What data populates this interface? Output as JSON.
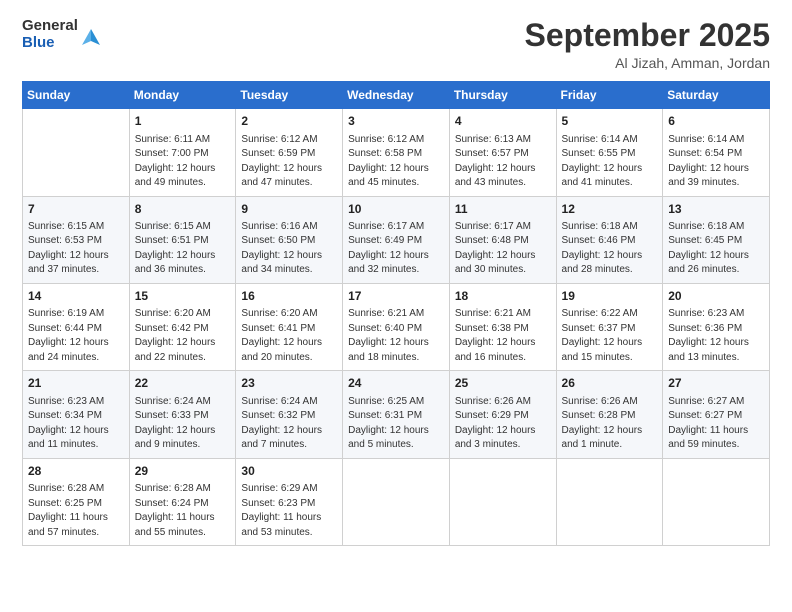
{
  "logo": {
    "line1": "General",
    "line2": "Blue"
  },
  "header": {
    "month": "September 2025",
    "location": "Al Jizah, Amman, Jordan"
  },
  "weekdays": [
    "Sunday",
    "Monday",
    "Tuesday",
    "Wednesday",
    "Thursday",
    "Friday",
    "Saturday"
  ],
  "weeks": [
    [
      {
        "day": "",
        "info": ""
      },
      {
        "day": "1",
        "info": "Sunrise: 6:11 AM\nSunset: 7:00 PM\nDaylight: 12 hours\nand 49 minutes."
      },
      {
        "day": "2",
        "info": "Sunrise: 6:12 AM\nSunset: 6:59 PM\nDaylight: 12 hours\nand 47 minutes."
      },
      {
        "day": "3",
        "info": "Sunrise: 6:12 AM\nSunset: 6:58 PM\nDaylight: 12 hours\nand 45 minutes."
      },
      {
        "day": "4",
        "info": "Sunrise: 6:13 AM\nSunset: 6:57 PM\nDaylight: 12 hours\nand 43 minutes."
      },
      {
        "day": "5",
        "info": "Sunrise: 6:14 AM\nSunset: 6:55 PM\nDaylight: 12 hours\nand 41 minutes."
      },
      {
        "day": "6",
        "info": "Sunrise: 6:14 AM\nSunset: 6:54 PM\nDaylight: 12 hours\nand 39 minutes."
      }
    ],
    [
      {
        "day": "7",
        "info": "Sunrise: 6:15 AM\nSunset: 6:53 PM\nDaylight: 12 hours\nand 37 minutes."
      },
      {
        "day": "8",
        "info": "Sunrise: 6:15 AM\nSunset: 6:51 PM\nDaylight: 12 hours\nand 36 minutes."
      },
      {
        "day": "9",
        "info": "Sunrise: 6:16 AM\nSunset: 6:50 PM\nDaylight: 12 hours\nand 34 minutes."
      },
      {
        "day": "10",
        "info": "Sunrise: 6:17 AM\nSunset: 6:49 PM\nDaylight: 12 hours\nand 32 minutes."
      },
      {
        "day": "11",
        "info": "Sunrise: 6:17 AM\nSunset: 6:48 PM\nDaylight: 12 hours\nand 30 minutes."
      },
      {
        "day": "12",
        "info": "Sunrise: 6:18 AM\nSunset: 6:46 PM\nDaylight: 12 hours\nand 28 minutes."
      },
      {
        "day": "13",
        "info": "Sunrise: 6:18 AM\nSunset: 6:45 PM\nDaylight: 12 hours\nand 26 minutes."
      }
    ],
    [
      {
        "day": "14",
        "info": "Sunrise: 6:19 AM\nSunset: 6:44 PM\nDaylight: 12 hours\nand 24 minutes."
      },
      {
        "day": "15",
        "info": "Sunrise: 6:20 AM\nSunset: 6:42 PM\nDaylight: 12 hours\nand 22 minutes."
      },
      {
        "day": "16",
        "info": "Sunrise: 6:20 AM\nSunset: 6:41 PM\nDaylight: 12 hours\nand 20 minutes."
      },
      {
        "day": "17",
        "info": "Sunrise: 6:21 AM\nSunset: 6:40 PM\nDaylight: 12 hours\nand 18 minutes."
      },
      {
        "day": "18",
        "info": "Sunrise: 6:21 AM\nSunset: 6:38 PM\nDaylight: 12 hours\nand 16 minutes."
      },
      {
        "day": "19",
        "info": "Sunrise: 6:22 AM\nSunset: 6:37 PM\nDaylight: 12 hours\nand 15 minutes."
      },
      {
        "day": "20",
        "info": "Sunrise: 6:23 AM\nSunset: 6:36 PM\nDaylight: 12 hours\nand 13 minutes."
      }
    ],
    [
      {
        "day": "21",
        "info": "Sunrise: 6:23 AM\nSunset: 6:34 PM\nDaylight: 12 hours\nand 11 minutes."
      },
      {
        "day": "22",
        "info": "Sunrise: 6:24 AM\nSunset: 6:33 PM\nDaylight: 12 hours\nand 9 minutes."
      },
      {
        "day": "23",
        "info": "Sunrise: 6:24 AM\nSunset: 6:32 PM\nDaylight: 12 hours\nand 7 minutes."
      },
      {
        "day": "24",
        "info": "Sunrise: 6:25 AM\nSunset: 6:31 PM\nDaylight: 12 hours\nand 5 minutes."
      },
      {
        "day": "25",
        "info": "Sunrise: 6:26 AM\nSunset: 6:29 PM\nDaylight: 12 hours\nand 3 minutes."
      },
      {
        "day": "26",
        "info": "Sunrise: 6:26 AM\nSunset: 6:28 PM\nDaylight: 12 hours\nand 1 minute."
      },
      {
        "day": "27",
        "info": "Sunrise: 6:27 AM\nSunset: 6:27 PM\nDaylight: 11 hours\nand 59 minutes."
      }
    ],
    [
      {
        "day": "28",
        "info": "Sunrise: 6:28 AM\nSunset: 6:25 PM\nDaylight: 11 hours\nand 57 minutes."
      },
      {
        "day": "29",
        "info": "Sunrise: 6:28 AM\nSunset: 6:24 PM\nDaylight: 11 hours\nand 55 minutes."
      },
      {
        "day": "30",
        "info": "Sunrise: 6:29 AM\nSunset: 6:23 PM\nDaylight: 11 hours\nand 53 minutes."
      },
      {
        "day": "",
        "info": ""
      },
      {
        "day": "",
        "info": ""
      },
      {
        "day": "",
        "info": ""
      },
      {
        "day": "",
        "info": ""
      }
    ]
  ]
}
